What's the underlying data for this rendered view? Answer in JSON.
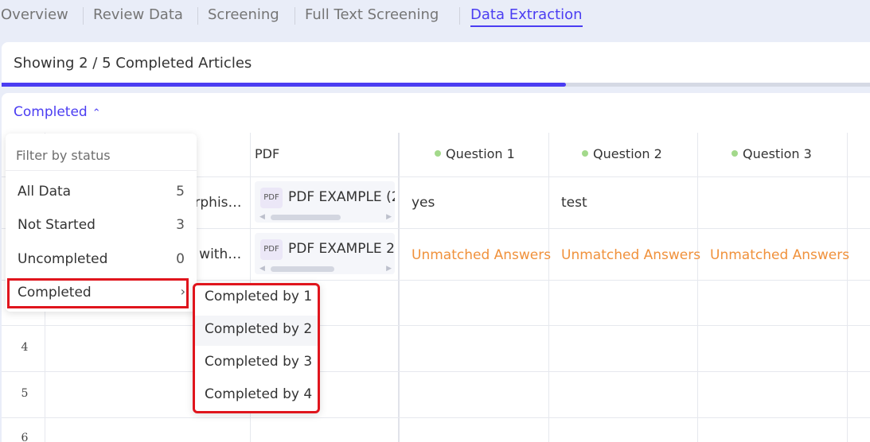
{
  "tabs": [
    "Overview",
    "Review Data",
    "Screening",
    "Full Text Screening",
    "Data Extraction"
  ],
  "active_tab": "Data Extraction",
  "summary": {
    "title": "Showing 2 / 5 Completed Articles",
    "progress_percent": 65
  },
  "status_toggle": {
    "label": "Completed",
    "chevron": "chevron-up-icon"
  },
  "table": {
    "columns": {
      "pdf": "PDF",
      "q1": "Question 1",
      "q2": "Question 2",
      "q3": "Question 3"
    },
    "rows": [
      {
        "title_fragment": "orphis…",
        "pdf": "PDF EXAMPLE (2",
        "q1": "yes",
        "q2": "test",
        "q3": ""
      },
      {
        "title_fragment": "n with…",
        "pdf": "PDF EXAMPLE 2",
        "q1": "Unmatched Answers",
        "q2": "Unmatched Answers",
        "q3": "Unmatched Answers"
      }
    ],
    "row_numbers": [
      "4",
      "5",
      "6"
    ],
    "pdf_badge": "PDF"
  },
  "filter_menu": {
    "title": "Filter by status",
    "items": [
      {
        "label": "All Data",
        "count": "5"
      },
      {
        "label": "Not Started",
        "count": "3"
      },
      {
        "label": "Uncompleted",
        "count": "0"
      },
      {
        "label": "Completed",
        "count": ""
      }
    ],
    "submenu_items": [
      "Completed by 1",
      "Completed by 2",
      "Completed by 3",
      "Completed by 4"
    ]
  },
  "colors": {
    "accent": "#4b3df2",
    "warning": "#f0913b",
    "status_dot": "#a3d98b",
    "highlight": "#e0151d"
  }
}
